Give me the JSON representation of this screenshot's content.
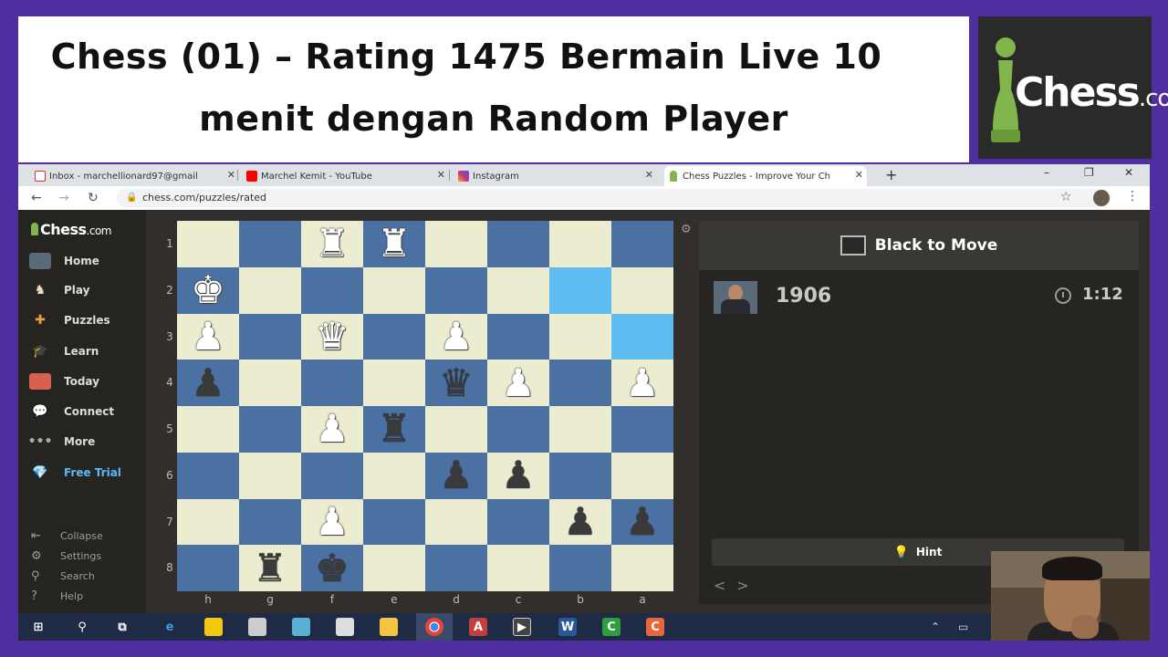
{
  "banner": {
    "line1": "Chess (01) – Rating 1475 Bermain Live 10",
    "line2": "menit dengan Random Player",
    "logo_text": "Chess",
    "logo_suffix": ".com"
  },
  "browser": {
    "tabs": [
      {
        "label": "Inbox - marchellionard97@gmail",
        "icon": "gmail-icon",
        "color": "#d93025"
      },
      {
        "label": "Marchel Kemit - YouTube",
        "icon": "youtube-icon",
        "color": "#ff0000"
      },
      {
        "label": "Instagram",
        "icon": "instagram-icon",
        "color": "#c13584"
      },
      {
        "label": "Chess Puzzles - Improve Your Ch",
        "icon": "chess-pawn-icon",
        "color": "#81b64c"
      }
    ],
    "new_tab": "+",
    "url": "chess.com/puzzles/rated",
    "window_controls": [
      "–",
      "❐",
      "✕"
    ]
  },
  "sidebar": {
    "logo": "Chess",
    "logo_suffix": ".com",
    "items": [
      {
        "label": "Home",
        "icon": "home-avatar-icon"
      },
      {
        "label": "Play",
        "icon": "play-icon"
      },
      {
        "label": "Puzzles",
        "icon": "puzzles-icon"
      },
      {
        "label": "Learn",
        "icon": "learn-icon"
      },
      {
        "label": "Today",
        "icon": "today-icon"
      },
      {
        "label": "Connect",
        "icon": "connect-icon"
      },
      {
        "label": "More",
        "icon": "more-icon"
      },
      {
        "label": "Free Trial",
        "icon": "diamond-icon"
      }
    ],
    "footer": [
      {
        "label": "Collapse",
        "icon": "collapse-icon"
      },
      {
        "label": "Settings",
        "icon": "gear-icon"
      },
      {
        "label": "Search",
        "icon": "search-icon"
      },
      {
        "label": "Help",
        "icon": "help-icon"
      }
    ]
  },
  "board": {
    "ranks": [
      "1",
      "2",
      "3",
      "4",
      "5",
      "6",
      "7",
      "8"
    ],
    "files": [
      "h",
      "g",
      "f",
      "e",
      "d",
      "c",
      "b",
      "a"
    ],
    "highlight": [
      "6-1",
      "7-2"
    ],
    "pieces": [
      {
        "rank": 0,
        "file": 2,
        "glyph": "♜",
        "side": "w"
      },
      {
        "rank": 0,
        "file": 3,
        "glyph": "♜",
        "side": "w"
      },
      {
        "rank": 1,
        "file": 0,
        "glyph": "♚",
        "side": "w"
      },
      {
        "rank": 2,
        "file": 0,
        "glyph": "♟",
        "side": "w"
      },
      {
        "rank": 2,
        "file": 2,
        "glyph": "♛",
        "side": "w"
      },
      {
        "rank": 2,
        "file": 4,
        "glyph": "♟",
        "side": "w"
      },
      {
        "rank": 3,
        "file": 0,
        "glyph": "♟",
        "side": "b"
      },
      {
        "rank": 3,
        "file": 4,
        "glyph": "♛",
        "side": "b"
      },
      {
        "rank": 3,
        "file": 5,
        "glyph": "♟",
        "side": "w"
      },
      {
        "rank": 3,
        "file": 7,
        "glyph": "♟",
        "side": "w"
      },
      {
        "rank": 4,
        "file": 2,
        "glyph": "♟",
        "side": "w"
      },
      {
        "rank": 4,
        "file": 3,
        "glyph": "♜",
        "side": "b"
      },
      {
        "rank": 5,
        "file": 4,
        "glyph": "♟",
        "side": "b"
      },
      {
        "rank": 5,
        "file": 5,
        "glyph": "♟",
        "side": "b"
      },
      {
        "rank": 6,
        "file": 2,
        "glyph": "♟",
        "side": "w"
      },
      {
        "rank": 6,
        "file": 6,
        "glyph": "♟",
        "side": "b"
      },
      {
        "rank": 6,
        "file": 7,
        "glyph": "♟",
        "side": "b"
      },
      {
        "rank": 7,
        "file": 1,
        "glyph": "♜",
        "side": "b"
      },
      {
        "rank": 7,
        "file": 2,
        "glyph": "♚",
        "side": "b"
      }
    ],
    "light_color": "#ebecd0",
    "dark_color": "#4b71a2",
    "highlight_color": "#5fbcf0"
  },
  "panel": {
    "side_to_move": "Black to Move",
    "rating": "1906",
    "timer": "1:12",
    "hint_label": "Hint"
  },
  "taskbar": {
    "icons": [
      "windows-icon",
      "search-icon",
      "task-view-icon",
      "edge-icon",
      "sticky-notes-icon",
      "paint-icon",
      "photos-icon",
      "snipping-icon",
      "file-explorer-icon",
      "chrome-icon",
      "access-icon",
      "video-editor-icon",
      "word-icon",
      "camtasia-icon",
      "camtasia-recorder-icon"
    ]
  }
}
